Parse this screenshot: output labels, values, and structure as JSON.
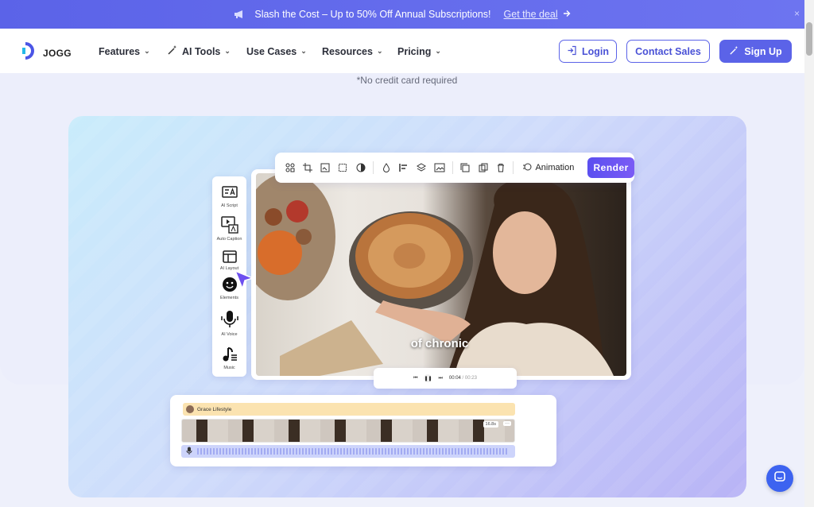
{
  "promo": {
    "text": "Slash the Cost – Up to 50% Off Annual Subscriptions!",
    "link_text": "Get the deal",
    "close": "×"
  },
  "nav": {
    "logo_text": "JOGG",
    "menu": [
      {
        "label": "Features"
      },
      {
        "label": "AI Tools"
      },
      {
        "label": "Use Cases"
      },
      {
        "label": "Resources"
      },
      {
        "label": "Pricing"
      }
    ],
    "login": "Login",
    "contact": "Contact Sales",
    "signup": "Sign Up"
  },
  "hero": {
    "no_credit": "*No credit card required"
  },
  "editor": {
    "toolbar_icons": [
      "group-icon",
      "crop-icon",
      "replace-icon",
      "frame-icon",
      "contrast-icon",
      "opacity-icon",
      "align-icon",
      "layers-icon",
      "image-icon",
      "copy-icon",
      "duplicate-icon",
      "delete-icon"
    ],
    "animation": "Animation",
    "render": "Render",
    "side_tools": [
      {
        "label": "AI Script"
      },
      {
        "label": "Auto Caption"
      },
      {
        "label": "AI Layout"
      },
      {
        "label": "Elements"
      },
      {
        "label": "AI Voice"
      },
      {
        "label": "Music"
      }
    ],
    "caption": "of chronic",
    "player": {
      "current": "00:04",
      "separator": " / ",
      "total": "00:23"
    },
    "timeline": {
      "track_name": "Grace Lifestyle",
      "duration": "16.8s",
      "more": "···"
    }
  },
  "colors": {
    "accent": "#5b63e8",
    "render": "#6a55f2",
    "chat": "#3d63f0"
  }
}
